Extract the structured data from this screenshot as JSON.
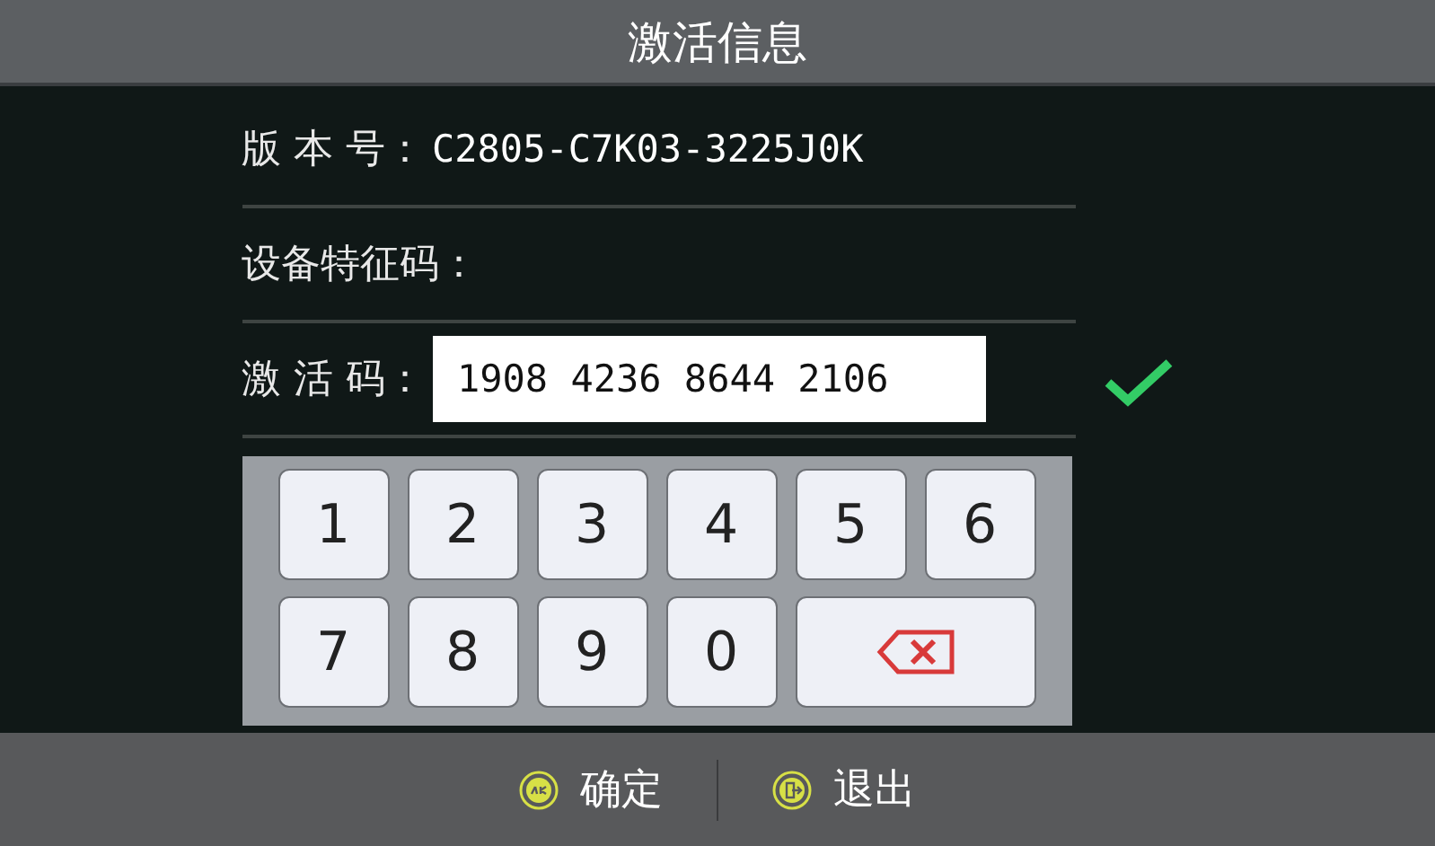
{
  "window": {
    "title": "激活信息"
  },
  "fields": [
    {
      "label": "版 本 号：",
      "value": "C2805-C7K03-3225J0K",
      "kind": "text"
    },
    {
      "label": "设备特征码：",
      "kind": "text"
    },
    {
      "label": "激 活 码：",
      "value": "1908 4236 8644 2106",
      "kind": "input",
      "valid": true
    }
  ],
  "keypad": [
    {
      "kind": "digit",
      "label": "1"
    },
    {
      "kind": "digit",
      "label": "2"
    },
    {
      "kind": "digit",
      "label": "3"
    },
    {
      "kind": "digit",
      "label": "4"
    },
    {
      "kind": "digit",
      "label": "5"
    },
    {
      "kind": "digit",
      "label": "6"
    },
    {
      "kind": "digit",
      "label": "7"
    },
    {
      "kind": "digit",
      "label": "8"
    },
    {
      "kind": "digit",
      "label": "9"
    },
    {
      "kind": "digit",
      "label": "0"
    },
    {
      "kind": "backspace"
    }
  ],
  "buttons": [
    {
      "kind": "ok",
      "label": "确定"
    },
    {
      "kind": "exit",
      "label": "退出"
    }
  ]
}
